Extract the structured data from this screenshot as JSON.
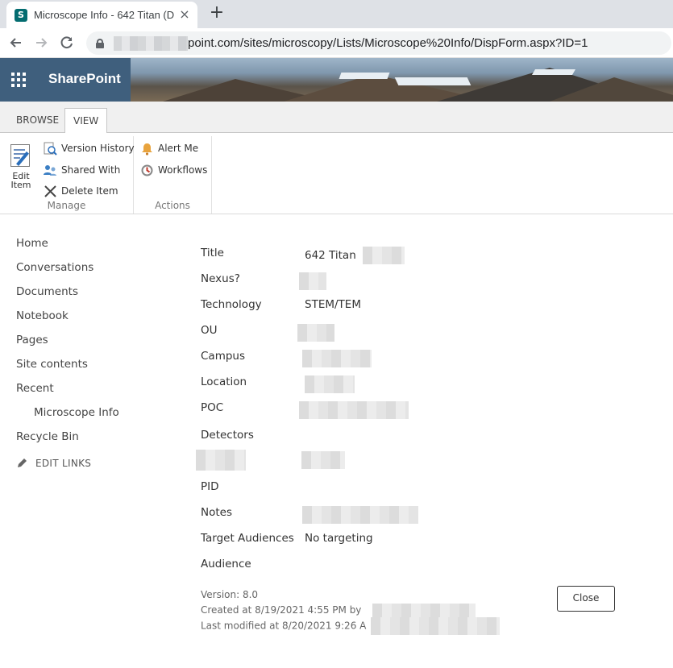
{
  "browser": {
    "tab_title": "Microscope Info - 642 Titan (D",
    "tab_favicon": "S",
    "url_text": "point.com/sites/microscopy/Lists/Microscope%20Info/DispForm.aspx?ID=1"
  },
  "suitebar": {
    "brand": "SharePoint"
  },
  "ribbon": {
    "tabs": [
      {
        "label": "BROWSE"
      },
      {
        "label": "VIEW"
      }
    ],
    "manage": {
      "edit_item_line1": "Edit",
      "edit_item_line2": "Item",
      "version_history": "Version History",
      "shared_with": "Shared With",
      "delete_item": "Delete Item",
      "group_label": "Manage"
    },
    "actions": {
      "alert_me": "Alert Me",
      "workflows": "Workflows",
      "group_label": "Actions"
    }
  },
  "quicklaunch": {
    "items": [
      {
        "label": "Home"
      },
      {
        "label": "Conversations"
      },
      {
        "label": "Documents"
      },
      {
        "label": "Notebook"
      },
      {
        "label": "Pages"
      },
      {
        "label": "Site contents"
      },
      {
        "label": "Recent"
      },
      {
        "label": "Microscope Info"
      },
      {
        "label": "Recycle Bin"
      }
    ],
    "edit_links": "EDIT LINKS"
  },
  "form": {
    "title_label": "Title",
    "title_value": "642 Titan",
    "nexus_label": "Nexus?",
    "technology_label": "Technology",
    "technology_value": "STEM/TEM",
    "ou_label": "OU",
    "campus_label": "Campus",
    "location_label": "Location",
    "poc_label": "POC",
    "detectors_label": "Detectors",
    "pid_label": "PID",
    "notes_label": "Notes",
    "target_label": "Target Audiences",
    "target_value": "No targeting",
    "audience_label": "Audience"
  },
  "meta": {
    "version": "Version: 8.0",
    "created": "Created at 8/19/2021 4:55 PM  by",
    "modified": "Last modified at 8/20/2021 9:26 A"
  },
  "close_button": "Close"
}
